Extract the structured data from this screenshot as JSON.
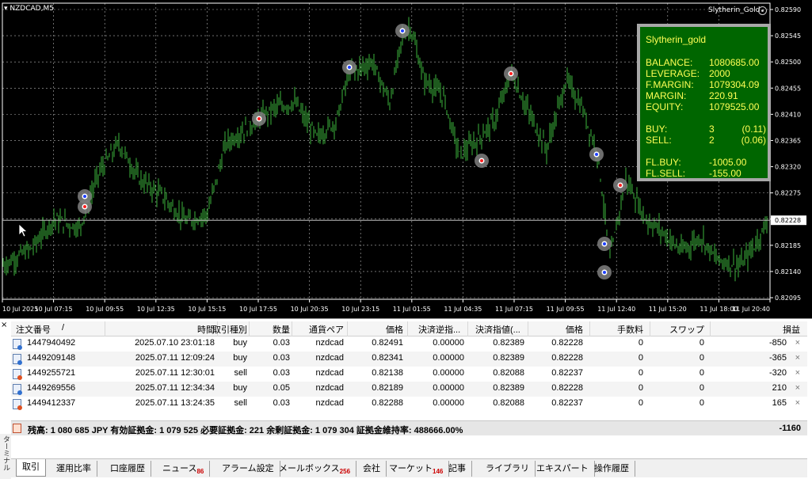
{
  "chart": {
    "symbol_title": "NZDCAD,M5",
    "ea_name": "Slytherin_Gold",
    "current_price": "0.82228",
    "price_labels": [
      "0.82590",
      "0.82545",
      "0.82500",
      "0.82455",
      "0.82410",
      "0.82365",
      "0.82320",
      "0.82275",
      "0.82230",
      "0.82185",
      "0.82140",
      "0.82095"
    ],
    "time_labels": [
      "10 Jul 2025",
      "10 Jul 07:15",
      "10 Jul 09:55",
      "10 Jul 12:35",
      "10 Jul 15:15",
      "10 Jul 17:55",
      "10 Jul 20:35",
      "10 Jul 23:15",
      "11 Jul 01:55",
      "11 Jul 04:35",
      "11 Jul 07:15",
      "11 Jul 09:55",
      "11 Jul 12:40",
      "11 Jul 15:20",
      "11 Jul 18:00",
      "11 Jul 20:40"
    ],
    "candle_color": "#3cb43c",
    "background_color": "#000000",
    "grid_color": "#ffffff",
    "trade_markers": [
      "buy",
      "sell",
      "buy",
      "sell",
      "buy",
      "buy",
      "sell",
      "sell",
      "buy",
      "sell",
      "buy",
      "sell"
    ]
  },
  "info_panel": {
    "title": "Slytherin_gold",
    "balance_label": "BALANCE:",
    "balance": "1080685.00",
    "leverage_label": "LEVERAGE:",
    "leverage": "2000",
    "fmargin_label": "F.MARGIN:",
    "fmargin": "1079304.09",
    "margin_label": "MARGIN:",
    "margin": "220.91",
    "equity_label": "EQUITY:",
    "equity": "1079525.00",
    "buy_label": "BUY:",
    "buy_count": "3",
    "buy_pl": "(0.11)",
    "sell_label": "SELL:",
    "sell_count": "2",
    "sell_pl": "(0.06)",
    "flbuy_label": "FL.BUY:",
    "flbuy": "-1005.00",
    "flsell_label": "FL.SELL:",
    "flsell": "-155.00",
    "bg_color": "#006600",
    "text_color": "#ffff55"
  },
  "terminal": {
    "side_label": "ターミナル",
    "close_glyph": "×",
    "headers": {
      "order": "注文番号",
      "time": "時間",
      "type": "取引種別",
      "size": "数量",
      "symbol": "通貨ペア",
      "price": "価格",
      "sl": "決済逆指...",
      "tp": "決済指値(...",
      "cur_price": "価格",
      "commission": "手数料",
      "swap": "スワップ",
      "profit": "損益"
    },
    "sort_indicator": "/",
    "orders": [
      {
        "id": "1447940492",
        "time": "2025.07.10 23:01:18",
        "type": "buy",
        "size": "0.03",
        "symbol": "nzdcad",
        "price": "0.82491",
        "sl": "0.00000",
        "tp": "0.82389",
        "cur": "0.82228",
        "commission": "0",
        "swap": "0",
        "profit": "-850"
      },
      {
        "id": "1449209148",
        "time": "2025.07.11 12:09:24",
        "type": "buy",
        "size": "0.03",
        "symbol": "nzdcad",
        "price": "0.82341",
        "sl": "0.00000",
        "tp": "0.82389",
        "cur": "0.82228",
        "commission": "0",
        "swap": "0",
        "profit": "-365"
      },
      {
        "id": "1449255721",
        "time": "2025.07.11 12:30:01",
        "type": "sell",
        "size": "0.03",
        "symbol": "nzdcad",
        "price": "0.82138",
        "sl": "0.00000",
        "tp": "0.82088",
        "cur": "0.82237",
        "commission": "0",
        "swap": "0",
        "profit": "-320"
      },
      {
        "id": "1449269556",
        "time": "2025.07.11 12:34:34",
        "type": "buy",
        "size": "0.05",
        "symbol": "nzdcad",
        "price": "0.82189",
        "sl": "0.00000",
        "tp": "0.82389",
        "cur": "0.82228",
        "commission": "0",
        "swap": "0",
        "profit": "210"
      },
      {
        "id": "1449412337",
        "time": "2025.07.11 13:24:35",
        "type": "sell",
        "size": "0.03",
        "symbol": "nzdcad",
        "price": "0.82288",
        "sl": "0.00000",
        "tp": "0.82088",
        "cur": "0.82237",
        "commission": "0",
        "swap": "0",
        "profit": "165"
      }
    ],
    "summary": "残高: 1 080 685 JPY  有効証拠金: 1 079 525  必要証拠金: 221  余剰証拠金: 1 079 304  証拠金維持率: 488666.00%",
    "summary_total": "-1160",
    "tabs": [
      {
        "label": "取引",
        "badge": ""
      },
      {
        "label": "運用比率",
        "badge": ""
      },
      {
        "label": "口座履歴",
        "badge": ""
      },
      {
        "label": "ニュース",
        "badge": "86"
      },
      {
        "label": "アラーム設定",
        "badge": ""
      },
      {
        "label": "メールボックス",
        "badge": "256"
      },
      {
        "label": "会社",
        "badge": ""
      },
      {
        "label": "マーケット",
        "badge": "146"
      },
      {
        "label": "記事",
        "badge": ""
      },
      {
        "label": "ライブラリ",
        "badge": ""
      },
      {
        "label": "エキスパート",
        "badge": ""
      },
      {
        "label": "操作履歴",
        "badge": ""
      }
    ]
  }
}
